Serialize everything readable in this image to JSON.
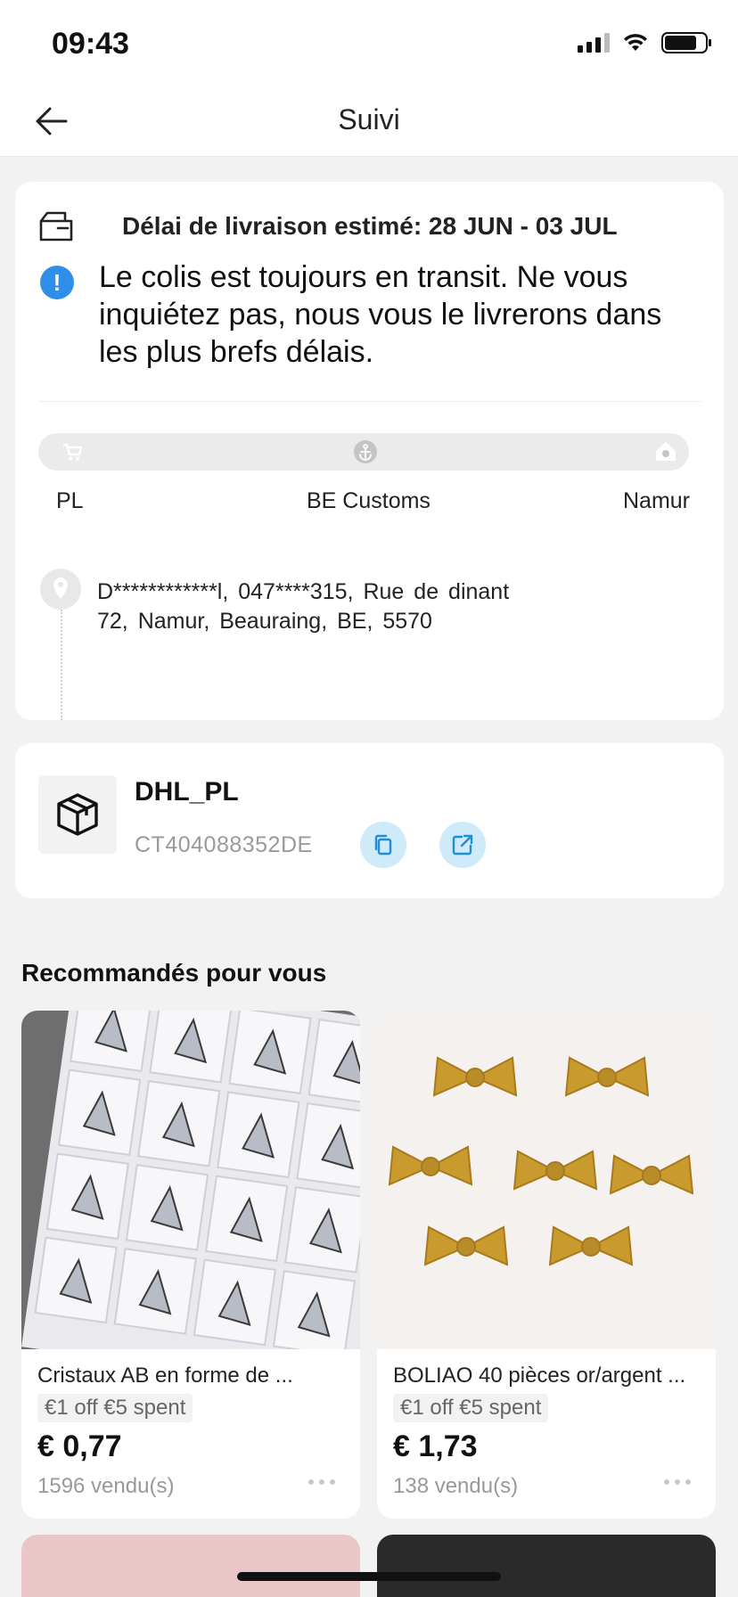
{
  "status_bar": {
    "time": "09:43"
  },
  "header": {
    "title": "Suivi"
  },
  "delivery": {
    "estimate": "Délai de livraison estimé: 28 JUN - 03 JUL",
    "message": "Le colis est toujours en transit. Ne vous inquiétez pas, nous vous le livrerons dans les plus brefs délais.",
    "steps": [
      {
        "label": "PL",
        "icon": "cart-icon"
      },
      {
        "label": "BE Customs",
        "icon": "anchor-icon"
      },
      {
        "label": "Namur",
        "icon": "house-icon"
      }
    ],
    "address_line1": "D************l, 047****315, Rue de dinant",
    "address_line2": "72, Namur, Beauraing, BE, 5570"
  },
  "shipment": {
    "carrier": "DHL_PL",
    "tracking_number": "CT404088352DE",
    "copy_icon": "copy-icon",
    "open_icon": "external-link-icon"
  },
  "recommendations": {
    "title": "Recommandés pour vous",
    "products": [
      {
        "name": "Cristaux AB en forme de ...",
        "promo": "€1 off €5 spent",
        "price": "€ 0,77",
        "sold": "1596 vendu(s)"
      },
      {
        "name": "BOLIAO 40 pièces or/argent ...",
        "promo": "€1 off €5 spent",
        "price": "€ 1,73",
        "sold": "138 vendu(s)"
      }
    ]
  },
  "colors": {
    "accent_blue": "#2f8ee8",
    "light_blue_button": "#cfeaf8",
    "background": "#f2f2f2",
    "gold": "#c99a2e"
  }
}
